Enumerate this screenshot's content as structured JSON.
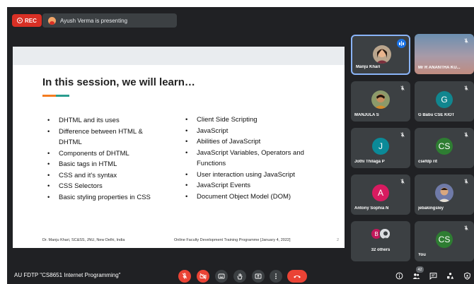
{
  "topbar": {
    "rec_label": "REC",
    "presenting_text": "Ayush Verma is presenting"
  },
  "slide": {
    "title": "In this session, we will learn…",
    "left_bullets": [
      "DHTML and its uses",
      "Difference between HTML & DHTML",
      "Components of DHTML",
      "Basic tags in HTML",
      "CSS and it's syntax",
      "CSS Selectors",
      "Basic styling properties in CSS"
    ],
    "right_bullets": [
      "Client Side Scripting",
      "JavaScript",
      "Abilities of JavaScript",
      "JavaScript Variables, Operators and Functions",
      "User interaction using JavaScript",
      "JavaScript Events",
      "Document Object Model (DOM)"
    ],
    "footer_left": "Dr. Manju Khari, SC&SS, JNU, New Delhi, India",
    "footer_mid": "Online Faculty Development Training Programme [January 4, 2022]",
    "page_number": "2"
  },
  "participants": {
    "manju": {
      "name": "Manju Khari"
    },
    "ananth": {
      "name": "Mr R ANANTHA KU..."
    },
    "manjula": {
      "name": "MANJULA S"
    },
    "gbabu": {
      "name": "G Babu CSE KIOT",
      "initial": "G"
    },
    "jothi": {
      "name": "Jothi Thilaga P",
      "initial": "J"
    },
    "csefdp": {
      "name": "csefdp rit",
      "initial": "CS"
    },
    "antony": {
      "name": "Antony Sophia N",
      "initial": "A"
    },
    "jeba": {
      "name": "jebakingsley"
    },
    "others": {
      "name": "32 others",
      "initial": "B"
    },
    "you": {
      "name": "You",
      "initial": "CS"
    }
  },
  "colors": {
    "gbabu": "#11868f",
    "jothi": "#0b8a98",
    "csefdp": "#2e7d32",
    "antony": "#d81b60",
    "you": "#2e7d32",
    "record": "#d93025",
    "speaking": "#1a73e8"
  },
  "bottombar": {
    "meeting_title": "AU FDTP \"CS8651 Internet Programming\"",
    "people_count": "42",
    "controls": [
      "mic-off-icon",
      "camera-off-icon",
      "captions-icon",
      "raise-hand-icon",
      "present-icon",
      "more-icon",
      "leave-call-icon"
    ],
    "side": [
      "info-icon",
      "people-icon",
      "chat-icon",
      "activities-icon",
      "host-controls-icon"
    ]
  }
}
